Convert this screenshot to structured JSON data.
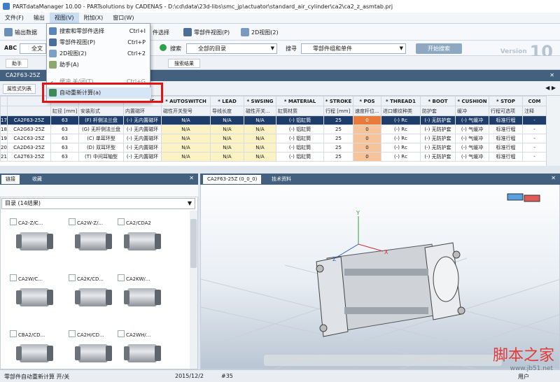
{
  "window": {
    "title": "PARTdataManager 10.00 - PARTsolutions by CADENAS - D:\\cd\\data\\23d-libs\\smc_jp\\actuator\\standard_air_cylinder\\ca2\\ca2_z_asmtab.prj"
  },
  "menubar": [
    "文件(F)",
    "输出",
    "视图(V)",
    "附加(X)",
    "窗口(W)"
  ],
  "toolbar": {
    "btn1": "输出数据",
    "btn2": "件选择",
    "btn3": "零部件视图(P)",
    "btn4": "2D视图(2)"
  },
  "search": {
    "abc": "ABC",
    "field_a": "全文",
    "label": "搜索",
    "scope": "全部的目录",
    "filter_label": "搜寻",
    "filter_value": "零部件组和单件",
    "start": "开始搜索"
  },
  "version": {
    "text": "Version",
    "num": "10"
  },
  "small_tabs": [
    "助手",
    "搜索结果"
  ],
  "dropdown": {
    "items": [
      {
        "label": "搜索和零部件选择",
        "shortcut": "Ctrl+I",
        "icon": "search-select-icon"
      },
      {
        "label": "零部件视图(P)",
        "shortcut": "Ctrl+P",
        "icon": "part-view-icon"
      },
      {
        "label": "2D视图(2)",
        "shortcut": "Ctrl+2",
        "icon": "view-2d-icon"
      },
      {
        "label": "助手(A)",
        "shortcut": "",
        "icon": "assistant-icon"
      },
      {
        "label": "缓冲 关/闭(T)",
        "shortcut": "Ctrl+G",
        "icon": "check-icon"
      },
      {
        "label": "自动重新计算(a)",
        "shortcut": "",
        "icon": "recalc-icon"
      }
    ]
  },
  "panel": {
    "title": "CA2F63-25Z",
    "subtab": "属性式列表"
  },
  "table": {
    "headers": [
      "",
      "BORE",
      "MOUNT",
      "* MAGNE",
      "* AUTOSWITCH",
      "* LEAD",
      "* SWSING",
      "* MATERIAL",
      "* STROKE",
      "* POS",
      "* THREAD1",
      "* BOOT",
      "* CUSHION",
      "* STOP",
      "COM"
    ],
    "subheaders": [
      "",
      "缸径 [mm]",
      "安装形式",
      "内置磁环",
      "磁性开关型号",
      "导线长度",
      "磁性开关...",
      "缸筒材质",
      "行程 [mm]",
      "速度杆位...",
      "进口螺纹种类",
      "防护套",
      "缓冲",
      "行程可选项",
      "注释"
    ],
    "rows": [
      [
        "17",
        "CA2F63-25Z",
        "63",
        "(F) 杆侧法兰盘",
        "(-) 无内置磁环",
        "N/A",
        "N/A",
        "N/A",
        "(-) 铝缸筒",
        "25",
        "0",
        "(-) Rc",
        "(-) 无防护套",
        "(-) 气缓冲",
        "标准行程",
        "-"
      ],
      [
        "18",
        "CA2G63-25Z",
        "63",
        "(G) 无杆侧法兰盘",
        "(-) 无内置磁环",
        "N/A",
        "N/A",
        "N/A",
        "(-) 铝缸筒",
        "25",
        "0",
        "(-) Rc",
        "(-) 无防护套",
        "(-) 气缓冲",
        "标准行程",
        "-"
      ],
      [
        "19",
        "CA2C63-25Z",
        "63",
        "(C) 单耳环型",
        "(-) 无内置磁环",
        "N/A",
        "N/A",
        "N/A",
        "(-) 铝缸筒",
        "25",
        "0",
        "(-) Rc",
        "(-) 无防护套",
        "(-) 气缓冲",
        "标准行程",
        "-"
      ],
      [
        "20",
        "CA2D63-25Z",
        "63",
        "(D) 双耳环型",
        "(-) 无内置磁环",
        "N/A",
        "N/A",
        "N/A",
        "(-) 铝缸筒",
        "25",
        "0",
        "(-) Rc",
        "(-) 无防护套",
        "(-) 气缓冲",
        "标准行程",
        "-"
      ],
      [
        "21",
        "CA2T63-25Z",
        "63",
        "(T) 中间耳轴型",
        "(-) 无内置磁环",
        "N/A",
        "N/A",
        "N/A",
        "(-) 铝缸筒",
        "25",
        "0",
        "(-) Rc",
        "(-) 无防护套",
        "(-) 气缓冲",
        "标准行程",
        "-"
      ]
    ]
  },
  "left_panel": {
    "tabs": [
      "链接",
      "收藏"
    ],
    "dir": "目录 (14结果)",
    "cards": [
      "CA2-Z/C...",
      "CA2W-Z/...",
      "CA2/CDA2",
      "CA2W/C...",
      "CA2K/CD...",
      "CA2KW/...",
      "CBA2/CD...",
      "CA2H/CD...",
      "CA2WH/..."
    ]
  },
  "view3d": {
    "tabs": [
      "CA2F63-25Z (0_0_0)",
      "技术资料"
    ]
  },
  "status": {
    "left": "零部件自动重新计算 开/关",
    "date": "2015/12/2",
    "num": "#35",
    "user": "用户"
  },
  "watermark": {
    "text": "脚本之家",
    "url": "www.jb51.net"
  },
  "colors": {
    "header": "#44607f",
    "selected_row": "#1f3d6b",
    "highlight": "#e01414"
  }
}
